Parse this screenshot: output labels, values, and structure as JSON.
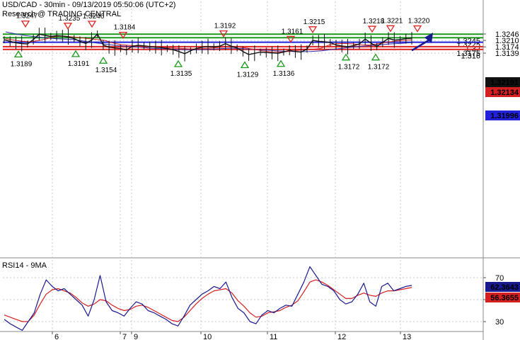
{
  "header": {
    "line1": "USD/CAD - 30min - 09/13/2019 05:50:06 (UTC+2)",
    "line2": "Research @ TRADING CENTRAL"
  },
  "colors": {
    "price": "#111111",
    "ma_red": "#d42020",
    "ma_blue": "#3030b0",
    "green_level": "#1a9a1a",
    "blue_level": "#2222dd",
    "red_level": "#dd2222",
    "arrow": "#1a1a90",
    "rsi": "#1a1a90",
    "rsi_ma": "#d42020",
    "grid": "#c8c8c8"
  },
  "chart_data": [
    {
      "type": "line",
      "title": "USD/CAD - 30min - 09/13/2019 05:50:06 (UTC+2)",
      "ylim": [
        1.3115,
        1.3258
      ],
      "x_ticks": [
        "6",
        "7",
        "9",
        "10",
        "11",
        "12",
        "13"
      ],
      "y_ticks": [
        "1.3246",
        "1.3210",
        "1.3174",
        "1.3139"
      ],
      "levels": [
        {
          "value": 1.3245,
          "label": "1.3245",
          "kind": "resistance"
        },
        {
          "value": 1.3225,
          "label": "1.3225",
          "kind": "resistance"
        },
        {
          "value": 1.32,
          "label": "1.32",
          "kind": "pivot"
        },
        {
          "value": 1.3175,
          "label": "1.3175",
          "kind": "support"
        },
        {
          "value": 1.316,
          "label": "1.316",
          "kind": "support"
        }
      ],
      "current_price": "1.32191",
      "ma_red_value": "1.32134",
      "ma_blue_value": "1.31996",
      "price_series": [
        1.3214,
        1.3205,
        1.3197,
        1.3192,
        1.319,
        1.3215,
        1.3245,
        1.3238,
        1.3232,
        1.3236,
        1.3234,
        1.323,
        1.322,
        1.3205,
        1.3193,
        1.3212,
        1.3246,
        1.3185,
        1.3172,
        1.3168,
        1.3165,
        1.3156,
        1.3178,
        1.3183,
        1.318,
        1.3176,
        1.3172,
        1.317,
        1.3165,
        1.3158,
        1.3148,
        1.3136,
        1.3152,
        1.3165,
        1.3172,
        1.3176,
        1.3174,
        1.3178,
        1.3192,
        1.3178,
        1.3168,
        1.3148,
        1.3131,
        1.3138,
        1.3145,
        1.3142,
        1.314,
        1.3138,
        1.3145,
        1.3155,
        1.3148,
        1.3145,
        1.3162,
        1.321,
        1.3205,
        1.3203,
        1.3198,
        1.3185,
        1.3179,
        1.3175,
        1.3181,
        1.319,
        1.3218,
        1.3195,
        1.3175,
        1.32,
        1.3221,
        1.3212,
        1.3215,
        1.322,
        1.3222
      ],
      "ma_red_series": [
        1.322,
        1.3212,
        1.3205,
        1.3202,
        1.321,
        1.322,
        1.3232,
        1.3234,
        1.323,
        1.3226,
        1.322,
        1.3215,
        1.321,
        1.3195,
        1.3186,
        1.3182,
        1.3178,
        1.3176,
        1.3173,
        1.317,
        1.3168,
        1.3166,
        1.3163,
        1.3162,
        1.3165,
        1.3168,
        1.3171,
        1.3175,
        1.3173,
        1.3168,
        1.316,
        1.3152,
        1.3146,
        1.3145,
        1.3148,
        1.3153,
        1.3158,
        1.316,
        1.3165,
        1.3184,
        1.3192,
        1.3193,
        1.319,
        1.3185,
        1.3184,
        1.3192,
        1.32,
        1.3206,
        1.321,
        1.3213
      ],
      "ma_blue_series": [
        1.3258,
        1.3245,
        1.3235,
        1.3228,
        1.3222,
        1.3218,
        1.3215,
        1.3205,
        1.3196,
        1.3188,
        1.3181,
        1.3176,
        1.3172,
        1.3166,
        1.3163,
        1.316,
        1.3158,
        1.3158,
        1.316,
        1.3164,
        1.3167,
        1.3164,
        1.316,
        1.3156,
        1.3152,
        1.3149,
        1.3147,
        1.3148,
        1.3152,
        1.316,
        1.3168,
        1.3174,
        1.318,
        1.3185,
        1.319,
        1.3193,
        1.3198
      ],
      "markers": [
        {
          "label": "1.3247",
          "dir": "up",
          "value": 1.3247
        },
        {
          "label": "1.3235",
          "dir": "up",
          "value": 1.3235
        },
        {
          "label": "1.3246",
          "dir": "up",
          "value": 1.3246
        },
        {
          "label": "1.3189",
          "dir": "down",
          "value": 1.3189
        },
        {
          "label": "1.3191",
          "dir": "down",
          "value": 1.3191
        },
        {
          "label": "1.3184",
          "dir": "up",
          "value": 1.3184
        },
        {
          "label": "1.3154",
          "dir": "down",
          "value": 1.3154
        },
        {
          "label": "1.3135",
          "dir": "down",
          "value": 1.3135
        },
        {
          "label": "1.3192",
          "dir": "up",
          "value": 1.3192
        },
        {
          "label": "1.3129",
          "dir": "down",
          "value": 1.3129
        },
        {
          "label": "1.3136",
          "dir": "down",
          "value": 1.3136
        },
        {
          "label": "1.3161",
          "dir": "up",
          "value": 1.3161
        },
        {
          "label": "1.3215",
          "dir": "up",
          "value": 1.3215
        },
        {
          "label": "1.3172",
          "dir": "down",
          "value": 1.3172
        },
        {
          "label": "1.3172",
          "dir": "down",
          "value": 1.3172
        },
        {
          "label": "1.3218",
          "dir": "up",
          "value": 1.3218
        },
        {
          "label": "1.3221",
          "dir": "up",
          "value": 1.3221
        },
        {
          "label": "1.3220",
          "dir": "up",
          "value": 1.322
        }
      ],
      "projection": {
        "from": 1.3225,
        "to": 1.3246
      }
    },
    {
      "type": "line",
      "title": "RSI14 - 9MA",
      "ylim": [
        15,
        90
      ],
      "y_ticks": [
        "70",
        "50",
        "30"
      ],
      "rsi_value": "62.3643",
      "rsi_ma_value": "56.3655",
      "rsi_series": [
        32,
        28,
        25,
        22,
        30,
        38,
        55,
        68,
        62,
        58,
        60,
        55,
        50,
        45,
        35,
        50,
        72,
        48,
        40,
        38,
        35,
        42,
        48,
        46,
        40,
        38,
        35,
        32,
        28,
        26,
        35,
        45,
        50,
        55,
        58,
        62,
        60,
        66,
        52,
        42,
        38,
        30,
        28,
        36,
        40,
        38,
        42,
        45,
        44,
        55,
        66,
        80,
        72,
        64,
        62,
        58,
        50,
        46,
        48,
        55,
        65,
        48,
        44,
        62,
        65,
        58,
        60,
        62,
        63
      ],
      "rsi_ma_series": [
        36,
        34,
        32,
        30,
        30,
        36,
        46,
        55,
        59,
        60,
        58,
        56,
        52,
        47,
        44,
        46,
        50,
        49,
        45,
        42,
        40,
        41,
        44,
        45,
        43,
        40,
        37,
        34,
        31,
        30,
        34,
        40,
        46,
        51,
        55,
        58,
        59,
        60,
        56,
        49,
        44,
        38,
        34,
        35,
        38,
        39,
        40,
        43,
        45,
        49,
        57,
        66,
        68,
        66,
        63,
        59,
        55,
        51,
        51,
        54,
        56,
        54,
        53,
        56,
        58,
        58,
        59,
        60,
        61
      ]
    }
  ]
}
